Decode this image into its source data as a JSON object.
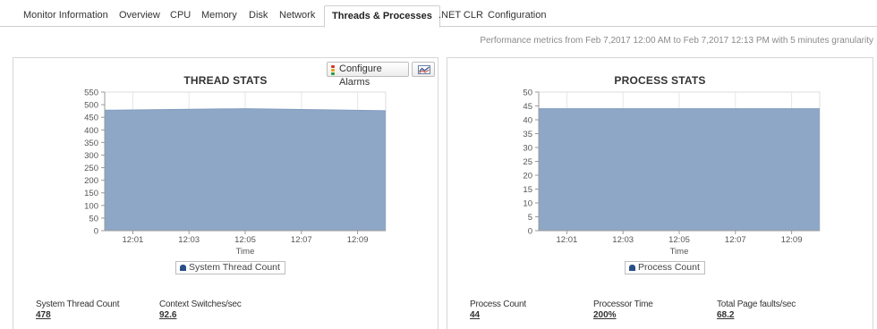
{
  "tabs": [
    {
      "label": "Monitor Information",
      "active": false
    },
    {
      "label": "Overview",
      "active": false
    },
    {
      "label": "CPU",
      "active": false
    },
    {
      "label": "Memory",
      "active": false
    },
    {
      "label": "Disk",
      "active": false
    },
    {
      "label": "Network",
      "active": false
    },
    {
      "label": "Threads & Processes",
      "active": true
    },
    {
      "label": ".NET CLR",
      "active": false
    },
    {
      "label": "Configuration",
      "active": false
    }
  ],
  "granularity_text": "Performance metrics from Feb 7,2017 12:00 AM to Feb 7,2017 12:13 PM with 5 minutes granularity",
  "thread_panel": {
    "configure_alarms_label": "Configure Alarms",
    "stats": [
      {
        "label": "System Thread Count",
        "value": "478"
      },
      {
        "label": "Context Switches/sec",
        "value": "92.6"
      }
    ]
  },
  "process_panel": {
    "stats": [
      {
        "label": "Process Count",
        "value": "44"
      },
      {
        "label": "Processor Time",
        "value": "200%"
      },
      {
        "label": "Total Page faults/sec",
        "value": "68.2"
      }
    ]
  },
  "colors": {
    "area_fill": "#8ea7c6",
    "area_line": "#7f9abf",
    "legend_marker": "#2a4f87"
  },
  "chart_data": [
    {
      "type": "area",
      "title": "THREAD STATS",
      "xlabel": "Time",
      "ylabel": "",
      "x_ticks": [
        "12:01",
        "12:03",
        "12:05",
        "12:07",
        "12:09"
      ],
      "ylim": [
        0,
        550
      ],
      "y_ticks": [
        0,
        50,
        100,
        150,
        200,
        250,
        300,
        350,
        400,
        450,
        500,
        550
      ],
      "grid": "vertical",
      "legend_position": "bottom",
      "series": [
        {
          "name": "System Thread Count",
          "x": [
            "12:00",
            "12:05",
            "12:10"
          ],
          "values": [
            478,
            484,
            476
          ]
        }
      ]
    },
    {
      "type": "area",
      "title": "PROCESS STATS",
      "xlabel": "Time",
      "ylabel": "",
      "x_ticks": [
        "12:01",
        "12:03",
        "12:05",
        "12:07",
        "12:09"
      ],
      "ylim": [
        0,
        50
      ],
      "y_ticks": [
        0,
        5,
        10,
        15,
        20,
        25,
        30,
        35,
        40,
        45,
        50
      ],
      "grid": "vertical",
      "legend_position": "bottom",
      "series": [
        {
          "name": "Process Count",
          "x": [
            "12:00",
            "12:05",
            "12:10"
          ],
          "values": [
            44,
            44,
            44
          ]
        }
      ]
    }
  ]
}
